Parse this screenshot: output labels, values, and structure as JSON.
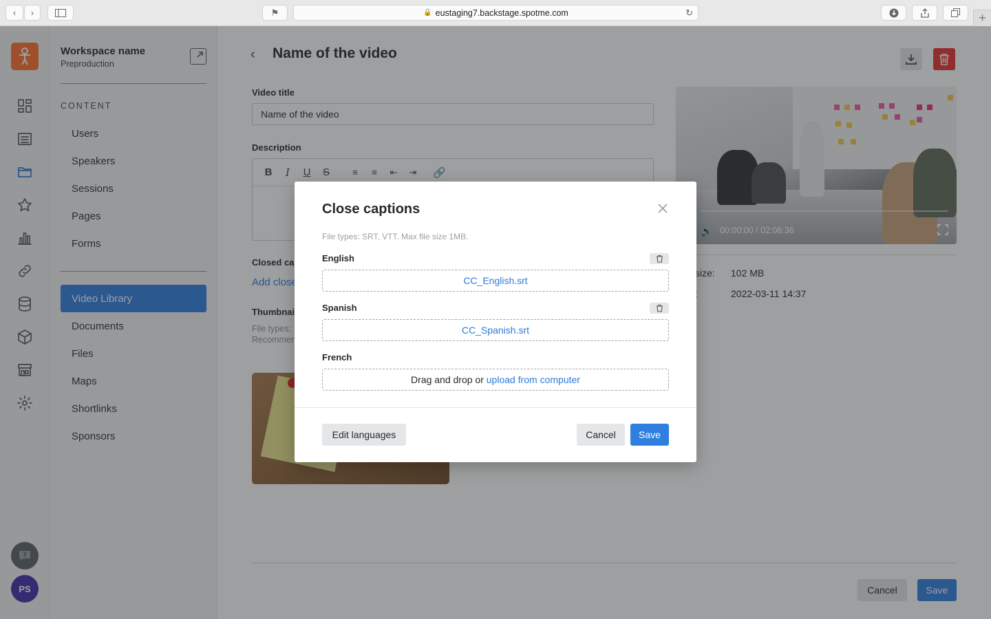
{
  "browser": {
    "url": "eustaging7.backstage.spotme.com",
    "lock_icon": "lock-icon"
  },
  "rail": {
    "icons": [
      "dashboard-icon",
      "list-icon",
      "folder-icon",
      "star-icon",
      "bar-chart-icon",
      "link-icon",
      "database-icon",
      "package-icon",
      "store-icon",
      "gear-icon"
    ],
    "active": "folder-icon",
    "help_icon": "help-icon",
    "avatar_initials": "PS"
  },
  "sidebar": {
    "workspace_name": "Workspace name",
    "workspace_sub": "Preproduction",
    "section_title": "CONTENT",
    "items_top": [
      {
        "label": "Users"
      },
      {
        "label": "Speakers"
      },
      {
        "label": "Sessions"
      },
      {
        "label": "Pages"
      },
      {
        "label": "Forms"
      }
    ],
    "items_bottom": [
      {
        "label": "Video Library",
        "active": true
      },
      {
        "label": "Documents"
      },
      {
        "label": "Files"
      },
      {
        "label": "Maps"
      },
      {
        "label": "Shortlinks"
      },
      {
        "label": "Sponsors"
      }
    ]
  },
  "main": {
    "title": "Name of the video",
    "video_title_label": "Video title",
    "video_title_value": "Name of the video",
    "description_label": "Description",
    "closed_captions_label": "Closed cap",
    "add_cc_link": "Add close",
    "thumbnail_label": "Thumbnail",
    "thumb_hint_1": "File types:",
    "thumb_hint_2": "Recommen",
    "video_time": "00:00:00 / 02:06:36",
    "meta": [
      {
        "label": "size:",
        "value": "102 MB"
      },
      {
        "label": ":",
        "value": "2022-03-11 14:37"
      }
    ],
    "footer_cancel": "Cancel",
    "footer_save": "Save"
  },
  "modal": {
    "title": "Close captions",
    "hint": "File types: SRT, VTT. Max file size 1MB.",
    "languages": [
      {
        "name": "English",
        "file": "CC_English.srt",
        "has_file": true
      },
      {
        "name": "Spanish",
        "file": "CC_Spanish.srt",
        "has_file": true
      },
      {
        "name": "French",
        "drop_text": "Drag and drop or",
        "upload_link": "upload from computer",
        "has_file": false
      }
    ],
    "edit_languages": "Edit languages",
    "cancel": "Cancel",
    "save": "Save"
  },
  "colors": {
    "accent": "#2f7fe1",
    "danger": "#e5322e",
    "brand": "#ff6f2c",
    "avatar": "#3e2ea8"
  }
}
